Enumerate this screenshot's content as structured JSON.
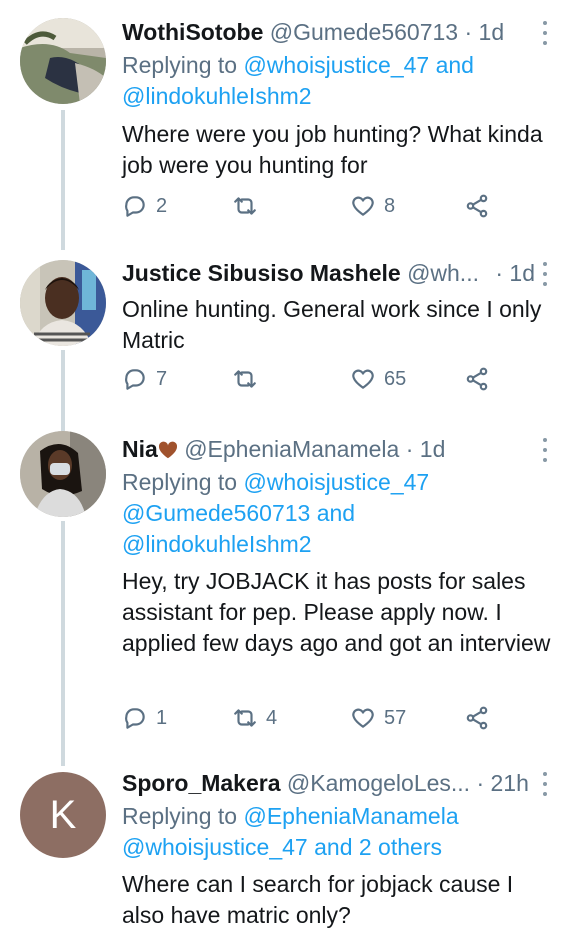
{
  "tweets": [
    {
      "name": "WothiSotobe",
      "handle": "@Gumede560713",
      "time": "· 1d",
      "replying_prefix": "Replying to",
      "replying_line1": "@whoisjustice_47 and",
      "replying_line2": "@lindokuhleIshm2",
      "text": "Where were you job hunting? What kinda job were you hunting for",
      "replies": "2",
      "retweets": "",
      "likes": "8"
    },
    {
      "name": "Justice Sibusiso Mashele",
      "handle": "@wh...",
      "time": "· 1d",
      "text": "Online hunting. General work since I only Matric",
      "replies": "7",
      "retweets": "",
      "likes": "65"
    },
    {
      "name": "Nia",
      "handle": "@EpheniaManamela",
      "time": "· 1d",
      "replying_prefix": "Replying to",
      "replying_line1": "@whoisjustice_47",
      "replying_line2": "@Gumede560713 and",
      "replying_line3": "@lindokuhleIshm2",
      "text": "Hey, try JOBJACK it has posts for sales assistant for pep. Please apply now. I applied few days ago and got an interview",
      "replies": "1",
      "retweets": "4",
      "likes": "57"
    },
    {
      "name": "Sporo_Makera",
      "handle": "@KamogeloLes...",
      "time": "· 21h",
      "avatar_letter": "K",
      "replying_prefix": "Replying to",
      "replying_line1": "@EpheniaManamela",
      "replying_line2": "@whoisjustice_47 and 2 others",
      "text": "Where can I search for jobjack cause I also have matric only?"
    }
  ],
  "icons": {
    "reply": "reply-icon",
    "retweet": "retweet-icon",
    "like": "heart-icon",
    "share": "share-icon",
    "more": "more-vertical-icon",
    "emoji": "brown-heart-emoji"
  },
  "colors": {
    "link": "#1da1f2",
    "secondary": "#5b7083",
    "thread_line": "#cfd9de",
    "avatar_k": "#8d6e63"
  }
}
